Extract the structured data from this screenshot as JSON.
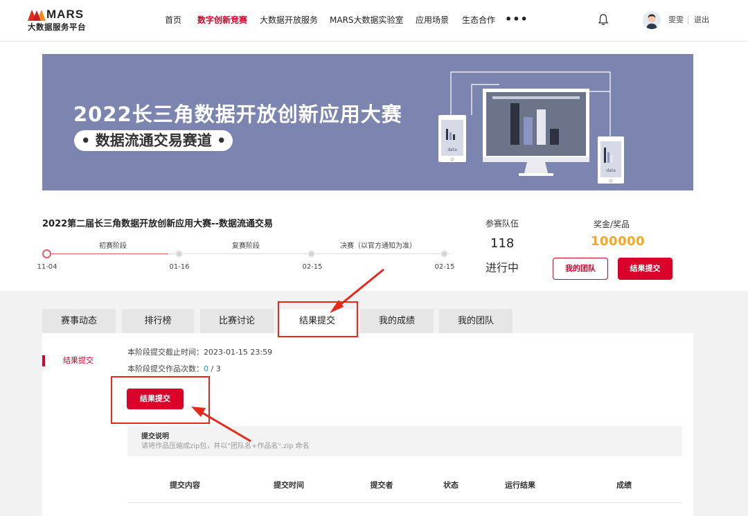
{
  "header": {
    "logo_text": "MARS",
    "logo_subtitle": "大数据服务平台",
    "nav": [
      {
        "label": "首页",
        "active": false
      },
      {
        "label": "数字创新竞赛",
        "active": true
      },
      {
        "label": "大数据开放服务",
        "active": false
      },
      {
        "label": "MARS大数据实验室",
        "active": false
      },
      {
        "label": "应用场景",
        "active": false
      },
      {
        "label": "生态合作",
        "active": false
      }
    ],
    "more": "•••",
    "username": "雯雯",
    "logout": "退出"
  },
  "banner": {
    "title": "2022长三角数据开放创新应用大赛",
    "track": "• 数据流通交易赛道 •",
    "device_label": "data"
  },
  "competition": {
    "title": "2022第二届长三角数据开放创新应用大赛--数据流通交易",
    "stages": [
      "初赛阶段",
      "复赛阶段",
      "决赛（以官方通知为准）"
    ],
    "dates": [
      "11-04",
      "01-16",
      "02-15",
      "02-15"
    ],
    "current_stage_progress": 0.95,
    "teams_label": "参赛队伍",
    "teams_count": "118",
    "status": "进行中",
    "prize_label": "奖金/奖品",
    "prize_value": "100000",
    "my_team_button": "我的团队",
    "submit_button": "结果提交"
  },
  "tabs": [
    {
      "label": "赛事动态",
      "active": false
    },
    {
      "label": "排行榜",
      "active": false
    },
    {
      "label": "比赛讨论",
      "active": false
    },
    {
      "label": "结果提交",
      "active": true
    },
    {
      "label": "我的成绩",
      "active": false
    },
    {
      "label": "我的团队",
      "active": false
    }
  ],
  "submission": {
    "side_menu": "结果提交",
    "deadline_label": "本阶段提交截止时间：",
    "deadline_value": "2023-01-15 23:59",
    "count_label": "本阶段提交作品次数：",
    "count_used": "0",
    "count_sep": " / ",
    "count_total": "3",
    "button": "结果提交",
    "notice_title": "提交说明",
    "notice_body": "请将作品压缩成zip包，并以\"团队名+作品名\".zip 命名",
    "columns": [
      "提交内容",
      "提交时间",
      "提交者",
      "状态",
      "运行结果",
      "成绩"
    ]
  },
  "colors": {
    "brand_red": "#d9002a",
    "prize_orange": "#f5a623",
    "banner_bg": "#7c85b0",
    "annotation_red": "#e8281a"
  }
}
